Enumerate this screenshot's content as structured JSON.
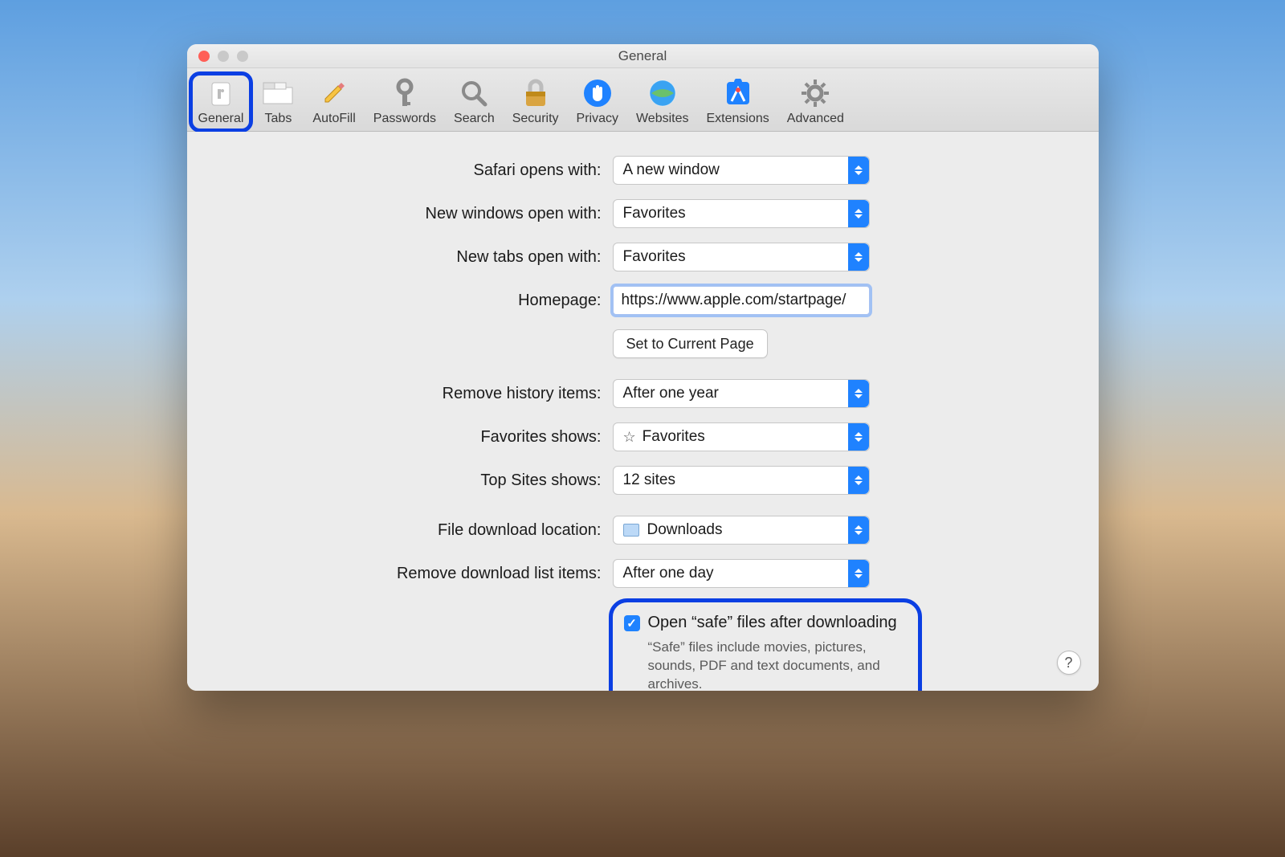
{
  "window": {
    "title": "General"
  },
  "toolbar": [
    {
      "label": "General",
      "icon": "switch-icon",
      "active": true
    },
    {
      "label": "Tabs",
      "icon": "tabs-icon",
      "active": false
    },
    {
      "label": "AutoFill",
      "icon": "pencil-icon",
      "active": false
    },
    {
      "label": "Passwords",
      "icon": "key-icon",
      "active": false
    },
    {
      "label": "Search",
      "icon": "search-icon",
      "active": false
    },
    {
      "label": "Security",
      "icon": "lock-icon",
      "active": false
    },
    {
      "label": "Privacy",
      "icon": "hand-icon",
      "active": false
    },
    {
      "label": "Websites",
      "icon": "globe-icon",
      "active": false
    },
    {
      "label": "Extensions",
      "icon": "puzzle-icon",
      "active": false
    },
    {
      "label": "Advanced",
      "icon": "gear-icon",
      "active": false
    }
  ],
  "labels": {
    "opens_with": "Safari opens with:",
    "new_windows": "New windows open with:",
    "new_tabs": "New tabs open with:",
    "homepage": "Homepage:",
    "set_current": "Set to Current Page",
    "remove_history": "Remove history items:",
    "favorites_shows": "Favorites shows:",
    "top_sites_shows": "Top Sites shows:",
    "download_location": "File download location:",
    "remove_downloads": "Remove download list items:"
  },
  "values": {
    "opens_with": "A new window",
    "new_windows": "Favorites",
    "new_tabs": "Favorites",
    "homepage": "https://www.apple.com/startpage/",
    "remove_history": "After one year",
    "favorites_shows": "Favorites",
    "top_sites_shows": "12 sites",
    "download_location": "Downloads",
    "remove_downloads": "After one day"
  },
  "safe": {
    "checked": true,
    "title": "Open “safe” files after downloading",
    "desc": "“Safe” files include movies, pictures, sounds, PDF and text documents, and archives."
  },
  "help": "?"
}
